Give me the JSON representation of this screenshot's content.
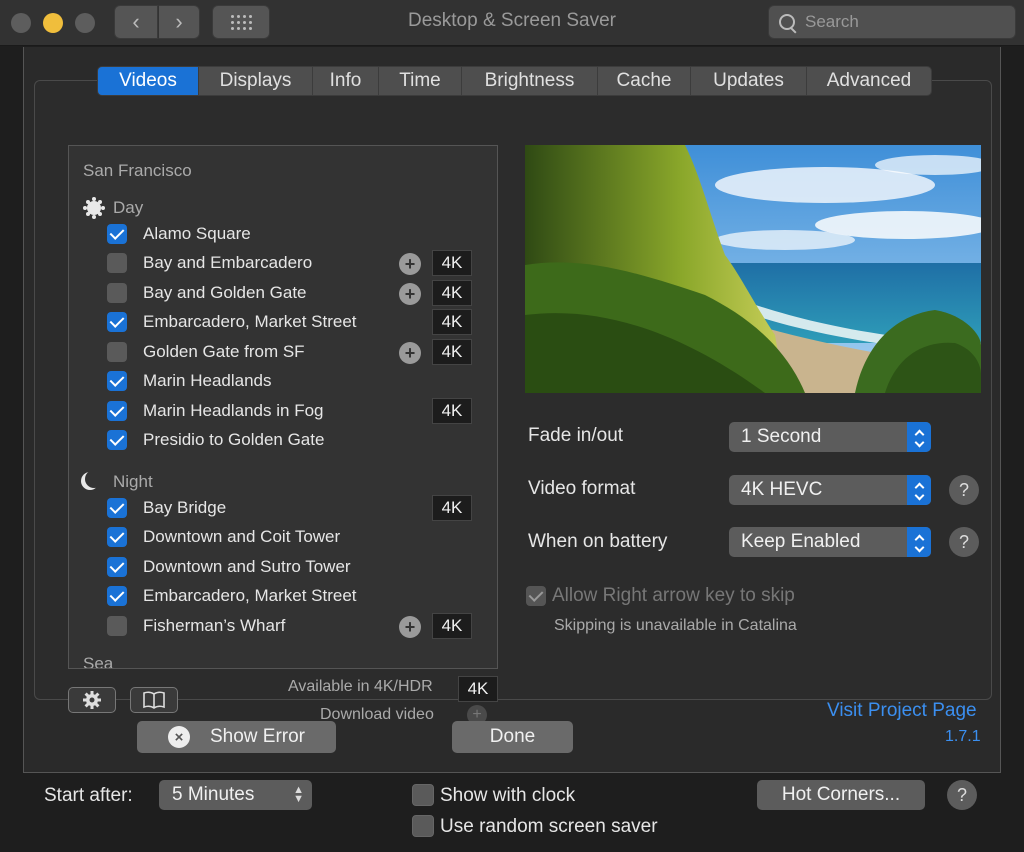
{
  "window": {
    "title": "Desktop & Screen Saver"
  },
  "search": {
    "placeholder": "Search"
  },
  "tabs": [
    {
      "label": "Videos",
      "active": true
    },
    {
      "label": "Displays"
    },
    {
      "label": "Info"
    },
    {
      "label": "Time"
    },
    {
      "label": "Brightness"
    },
    {
      "label": "Cache"
    },
    {
      "label": "Updates"
    },
    {
      "label": "Advanced"
    }
  ],
  "list": {
    "section": "San Francisco",
    "day_title": "Day",
    "day_items": [
      {
        "label": "Alamo Square",
        "checked": true,
        "plus": false,
        "badge": ""
      },
      {
        "label": "Bay and Embarcadero",
        "checked": false,
        "plus": true,
        "badge": "4K"
      },
      {
        "label": "Bay and Golden Gate",
        "checked": false,
        "plus": true,
        "badge": "4K"
      },
      {
        "label": "Embarcadero, Market Street",
        "checked": true,
        "plus": false,
        "badge": "4K"
      },
      {
        "label": "Golden Gate from SF",
        "checked": false,
        "plus": true,
        "badge": "4K"
      },
      {
        "label": "Marin Headlands",
        "checked": true,
        "plus": false,
        "badge": ""
      },
      {
        "label": "Marin Headlands in Fog",
        "checked": true,
        "plus": false,
        "badge": "4K"
      },
      {
        "label": "Presidio to Golden Gate",
        "checked": true,
        "plus": false,
        "badge": ""
      }
    ],
    "night_title": "Night",
    "night_items": [
      {
        "label": "Bay Bridge",
        "checked": true,
        "plus": false,
        "badge": "4K"
      },
      {
        "label": "Downtown and Coit Tower",
        "checked": true,
        "plus": false,
        "badge": ""
      },
      {
        "label": "Downtown and Sutro Tower",
        "checked": true,
        "plus": false,
        "badge": ""
      },
      {
        "label": "Embarcadero, Market Street",
        "checked": true,
        "plus": false,
        "badge": ""
      },
      {
        "label": "Fisherman’s Wharf",
        "checked": false,
        "plus": true,
        "badge": "4K"
      }
    ],
    "next_section": "Sea"
  },
  "list_footer": {
    "gear_icon": "gear-icon",
    "book_icon": "book-icon",
    "available_label": "Available in 4K/HDR",
    "available_badge": "4K",
    "download_label": "Download video",
    "download_plus": "+"
  },
  "settings": {
    "fade_label": "Fade in/out",
    "fade_value": "1 Second",
    "format_label": "Video format",
    "format_value": "4K HEVC",
    "battery_label": "When on battery",
    "battery_value": "Keep Enabled",
    "help": "?",
    "skip_label": "Allow Right arrow key to skip",
    "skip_note": "Skipping is unavailable in Catalina",
    "visit_link": "Visit Project Page"
  },
  "sheet_footer": {
    "error_label": "Show Error",
    "error_icon": "×",
    "done_label": "Done",
    "version": "1.7.1"
  },
  "bottom": {
    "start_after_label": "Start after:",
    "start_after_value": "5 Minutes",
    "show_clock_label": "Show with clock",
    "random_label": "Use random screen saver",
    "hot_corners_label": "Hot Corners...",
    "help": "?"
  },
  "colors": {
    "accent": "#1a72d6",
    "link": "#3b8ff0"
  }
}
